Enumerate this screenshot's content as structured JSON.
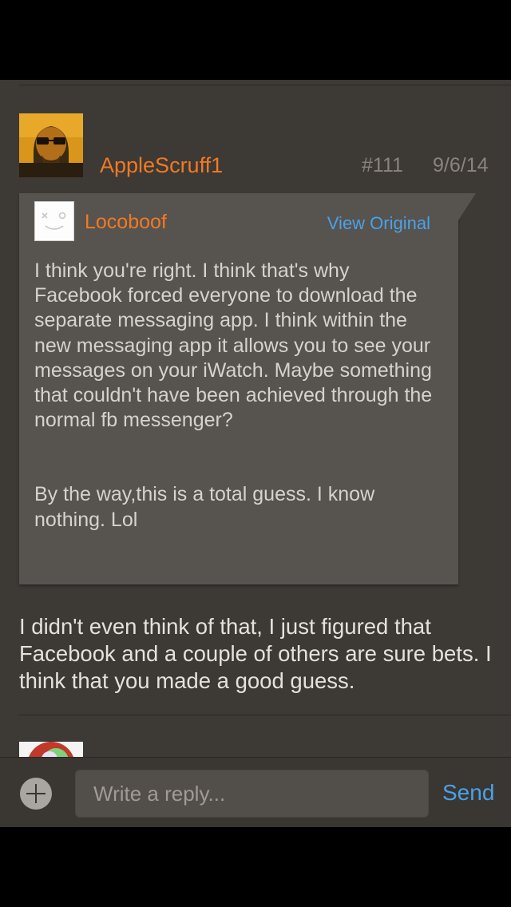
{
  "post": {
    "username": "AppleScruff1",
    "post_number": "#111",
    "date": "9/6/14",
    "quote": {
      "username": "Locoboof",
      "view_original_label": "View Original",
      "paragraph1": "I think you're right.  I think that's why Facebook forced everyone to download the separate messaging app.  I think within the new messaging app it allows you to see your messages on your iWatch.  Maybe something  that couldn't have been achieved through the normal fb messenger?",
      "paragraph2": "By the way,this is a total guess. I know nothing. Lol"
    },
    "body": "I didn't even think of that, I just figured that Facebook and a couple of others are sure bets. I think that you made a good guess."
  },
  "reply_bar": {
    "placeholder": "Write a reply...",
    "send_label": "Send"
  },
  "colors": {
    "accent_orange": "#f07a25",
    "link_blue": "#4aa2e8",
    "background": "#3d3935",
    "quote_background": "#57534f"
  }
}
